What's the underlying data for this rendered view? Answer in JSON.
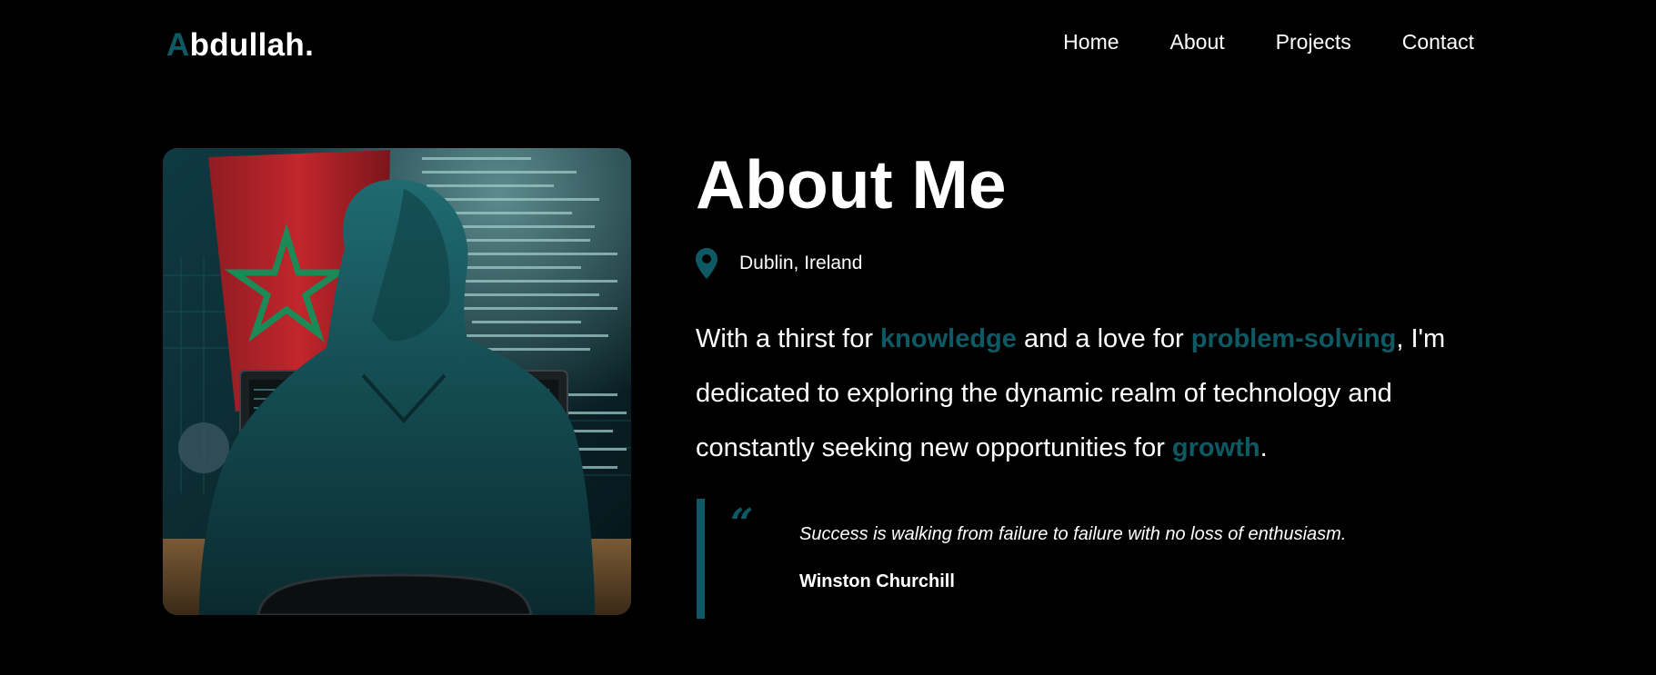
{
  "brand": {
    "first_letter": "A",
    "rest": "bdullah."
  },
  "nav": {
    "items": [
      "Home",
      "About",
      "Projects",
      "Contact"
    ]
  },
  "about": {
    "title": "About Me",
    "location": "Dublin, Ireland",
    "bio": {
      "p1": "With a thirst for ",
      "h1": "knowledge",
      "p2": " and a love for ",
      "h2": "problem-solving",
      "p3": ", I'm dedicated to exploring the dynamic realm of technology and constantly seeking new opportunities for ",
      "h3": "growth",
      "p4": "."
    },
    "quote": {
      "mark": "“",
      "text": "Success is walking from failure to failure with no loss of enthusiasm.",
      "author": "Winston Churchill"
    }
  },
  "image": {
    "icon": "hooded-hacker-image"
  },
  "colors": {
    "accent": "#0e5a64",
    "background": "#000000",
    "text": "#ffffff"
  }
}
